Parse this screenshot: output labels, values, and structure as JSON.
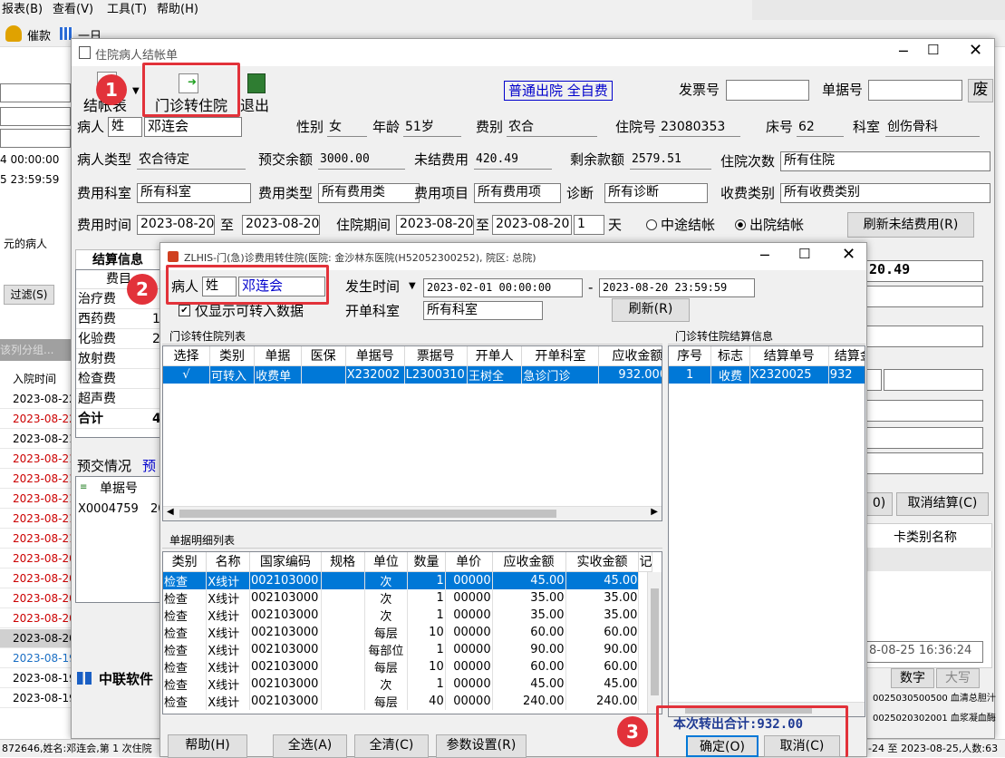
{
  "menu": [
    "报表(B)",
    "查看(V)",
    "工具(T)",
    "帮助(H)"
  ],
  "toolbar": {
    "cuikuan": "催款",
    "yiri": "一日"
  },
  "left_panel": {
    "time1": "4 00:00:00",
    "time2": "5 23:59:59",
    "label_patients": "元的病人",
    "filter_btn": "过滤(S)",
    "group_hint": "该列分组...",
    "col_admit": "入院时间",
    "rows": [
      "2023-08-22",
      "2023-08-22",
      "2023-08-21",
      "2023-08-21",
      "2023-08-21",
      "2023-08-21",
      "2023-08-21",
      "2023-08-21",
      "2023-08-20",
      "2023-08-20",
      "2023-08-20",
      "2023-08-20",
      "2023-08-20",
      "2023-08-19",
      "2023-08-19 17:...",
      "2023-08-19 14..."
    ],
    "row_tail": "2023-08-21"
  },
  "main_window": {
    "title": "住院病人结帐单",
    "tb_jiezhangbiao": "结帐表",
    "tb_menzhen": "门诊转住院",
    "tb_exit": "退出",
    "mode_label": "普通出院 全自费",
    "invoice_label": "发票号",
    "invoice_value": "",
    "doc_label": "单据号",
    "doc_value": "",
    "void_btn": "废",
    "patient_label": "病人",
    "patient_mode": "姓",
    "patient_name": "邓连会",
    "gender_label": "性别",
    "gender": "女",
    "age_label": "年龄",
    "age": "51岁",
    "fee_label": "费别",
    "fee": "农合",
    "admission_label": "住院号",
    "admission_no": "23080353",
    "bed_label": "床号",
    "bed": "62",
    "dept_label": "科室",
    "dept": "创伤骨科",
    "ptype_label": "病人类型",
    "ptype": "农合待定",
    "prepay_label": "预交余额",
    "prepay": "3000.00",
    "unsettled_label": "未结费用",
    "unsettled": "420.49",
    "remain_label": "剩余款额",
    "remain": "2579.51",
    "visits_label": "住院次数",
    "visits": "所有住院",
    "feedept_label": "费用科室",
    "feedept": "所有科室",
    "feetype_label": "费用类型",
    "feetype": "所有费用类",
    "feeitem_label": "费用项目",
    "feeitem": "所有费用项",
    "diag_label": "诊断",
    "diag": "所有诊断",
    "chargecat_label": "收费类别",
    "chargecat": "所有收费类别",
    "feetime_label": "费用时间",
    "feetime_from": "2023-08-20",
    "to1": "至",
    "feetime_to": "2023-08-20",
    "period_label": "住院期间",
    "period_from": "2023-08-20",
    "to2": "至",
    "period_to": "2023-08-20",
    "days": "1",
    "days_unit": "天",
    "radio_mid": "中途结帐",
    "radio_out": "出院结帐",
    "refresh_btn": "刷新未结费用(R)",
    "settle_tab": "结算信息",
    "settle_col": "费目",
    "settle_items": [
      "治疗费",
      "西药费",
      "化验费",
      "放射费",
      "检查费",
      "超声费",
      "合计"
    ],
    "settle_vals": [
      "",
      "1",
      "2",
      "",
      "",
      "",
      "42"
    ],
    "prepay_tab": "预交情况",
    "prepay_tab2": "预",
    "prepay_col": "单据号",
    "prepay_row": "X0004759",
    "prepay_row2": "20",
    "right_total": "20.49",
    "right_side": [
      "",
      "",
      "",
      "",
      "",
      "",
      "",
      ""
    ],
    "cancel_settle_btn": "取消结算(C)",
    "o_btn": "0)",
    "card_col": "卡类别名称",
    "timestamp": "8-08-25 16:36:24",
    "ime1": "数字",
    "ime2": "大写",
    "right_codes": [
      "0025030500500",
      "0025020302001"
    ],
    "right_names": [
      "血清总胆汁",
      "血浆凝血酶"
    ],
    "vendor": "中联软件"
  },
  "status_bar": {
    "left": "872646,姓名:邓连会,第 1 次住院",
    "right": "-24 至 2023-08-25,人数:63"
  },
  "dialog": {
    "title": "ZLHIS-门(急)诊费用转住院(医院: 金沙林东医院(H52052300252), 院区: 总院)",
    "patient_label": "病人",
    "patient_mode": "姓",
    "patient_name": "邓连会",
    "occur_label": "发生时间",
    "date_from": "2023-02-01 00:00:00",
    "dash": "-",
    "date_to": "2023-08-20 23:59:59",
    "only_label": "仅显示可转入数据",
    "dept_label": "开单科室",
    "dept_value": "所有科室",
    "refresh_btn": "刷新(R)",
    "list_header": "门诊转住院列表",
    "list_cols": [
      "选择",
      "类别",
      "单据",
      "医保",
      "单据号",
      "票据号",
      "开单人",
      "开单科室",
      "应收金额",
      "实"
    ],
    "list_row": [
      "√",
      "可转入",
      "收费单",
      "",
      "X232002",
      "L2300310",
      "王树全",
      "急诊门诊",
      "932.0000",
      "93"
    ],
    "settle_header": "门诊转住院结算信息",
    "settle_cols": [
      "序号",
      "标志",
      "结算单号",
      "结算金"
    ],
    "settle_row": [
      "1",
      "收费",
      "X2320025",
      "932"
    ],
    "detail_header": "单据明细列表",
    "detail_cols": [
      "类别",
      "名称",
      "国家编码",
      "规格",
      "单位",
      "数量",
      "单价",
      "应收金额",
      "实收金额",
      "记"
    ],
    "detail_rows": [
      [
        "检查",
        "X线计",
        "002103000",
        "",
        "次",
        "1",
        "00000",
        "45.00",
        "45.00"
      ],
      [
        "检查",
        "X线计",
        "002103000",
        "",
        "次",
        "1",
        "00000",
        "35.00",
        "35.00"
      ],
      [
        "检查",
        "X线计",
        "002103000",
        "",
        "次",
        "1",
        "00000",
        "35.00",
        "35.00"
      ],
      [
        "检查",
        "X线计",
        "002103000",
        "",
        "每层",
        "10",
        "00000",
        "60.00",
        "60.00"
      ],
      [
        "检查",
        "X线计",
        "002103000",
        "",
        "每部位",
        "1",
        "00000",
        "90.00",
        "90.00"
      ],
      [
        "检查",
        "X线计",
        "002103000",
        "",
        "每层",
        "10",
        "00000",
        "60.00",
        "60.00"
      ],
      [
        "检查",
        "X线计",
        "002103000",
        "",
        "次",
        "1",
        "00000",
        "45.00",
        "45.00"
      ],
      [
        "检查",
        "X线计",
        "002103000",
        "",
        "每层",
        "40",
        "00000",
        "240.00",
        "240.00"
      ]
    ],
    "total_label": "本次转出合计:932.00",
    "help_btn": "帮助(H)",
    "selectall_btn": "全选(A)",
    "clear_btn": "全清(C)",
    "param_btn": "参数设置(R)",
    "ok_btn": "确定(O)",
    "cancel_btn": "取消(C)"
  },
  "badges": [
    "1",
    "2",
    "3"
  ],
  "colors": {
    "accent_red": "#e2323a",
    "selection": "#0078d7",
    "link_blue": "#0000cc",
    "total_blue": "#1f3a93"
  }
}
